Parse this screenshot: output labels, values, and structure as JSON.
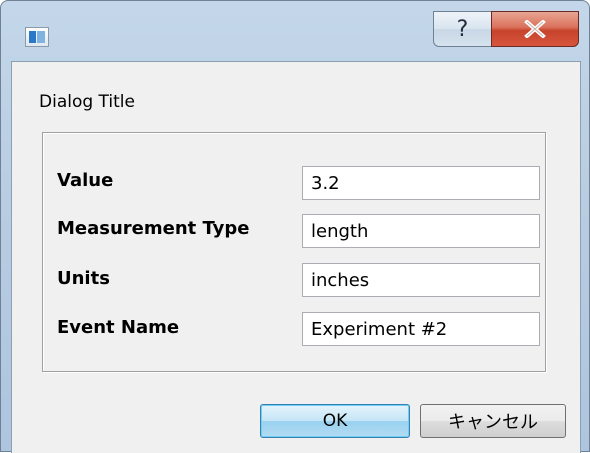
{
  "window": {
    "icon": "app-window-icon",
    "help_label": "?",
    "close_icon": "close-x-icon",
    "accent_close": "#c7432b",
    "frame_color": "#b9cde3"
  },
  "dialog": {
    "title": "Dialog Title"
  },
  "form": {
    "rows": [
      {
        "label": "Value",
        "value": "3.2"
      },
      {
        "label": "Measurement Type",
        "value": "length"
      },
      {
        "label": "Units",
        "value": "inches"
      },
      {
        "label": "Event Name",
        "value": "Experiment #2"
      }
    ]
  },
  "buttons": {
    "ok_label": "OK",
    "cancel_label": "キャンセル"
  }
}
